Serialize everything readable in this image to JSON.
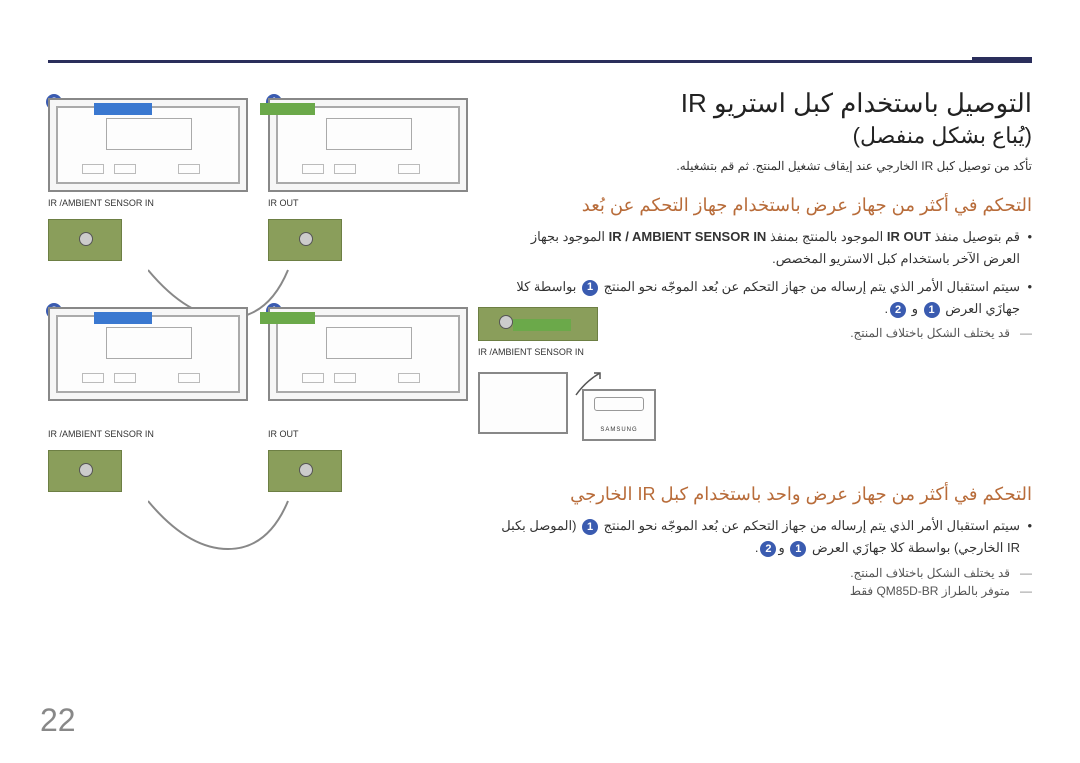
{
  "page_number": "22",
  "title_line1": "التوصيل باستخدام كبل استريو IR",
  "title_line2": "(يُباع بشكل منفصل)",
  "top_note": "تأكد من توصيل كبل IR الخارجي عند إيقاف تشغيل المنتج. ثم قم بتشغيله.",
  "section1_header": "التحكم في أكثر من جهاز عرض باستخدام جهاز التحكم عن بُعد",
  "s1_bullet1_pre": "قم بتوصيل منفذ ",
  "s1_bullet1_strong1": "IR OUT",
  "s1_bullet1_mid": " الموجود بالمنتج بمنفذ ",
  "s1_bullet1_strong2": "IR / AMBIENT SENSOR IN",
  "s1_bullet1_post": " الموجود بجهاز العرض الآخر باستخدام كبل الاستريو المخصص.",
  "s1_bullet2_part1": "سيتم استقبال الأمر الذي يتم إرساله من جهاز التحكم عن بُعد الموجّه نحو المنتج ",
  "s1_bullet2_part2": " بواسطة كلا جهازَي العرض ",
  "s1_bullet2_part3": " و ",
  "s1_bullet2_part4": ".",
  "s1_note": "قد يختلف الشكل باختلاف المنتج.",
  "section2_header": "التحكم في أكثر من جهاز عرض واحد باستخدام كبل IR الخارجي",
  "s2_bullet1_part1": "سيتم استقبال الأمر الذي يتم إرساله من جهاز التحكم عن بُعد الموجّه نحو المنتج ",
  "s2_bullet1_part2": " (الموصل بكبل IR الخارجي) بواسطة كلا جهازَي العرض ",
  "s2_bullet1_part3": " و",
  "s2_bullet1_part4": ".",
  "s2_note1": "قد يختلف الشكل باختلاف المنتج.",
  "s2_note2_pre": "متوفر بالطراز ",
  "s2_note2_model": "QM85D-BR",
  "s2_note2_post": " فقط",
  "labels": {
    "ir_out": "IR OUT",
    "ir_ambient_sensor_in": "IR /AMBIENT SENSOR IN"
  },
  "badges": {
    "one": "1",
    "two": "2"
  }
}
